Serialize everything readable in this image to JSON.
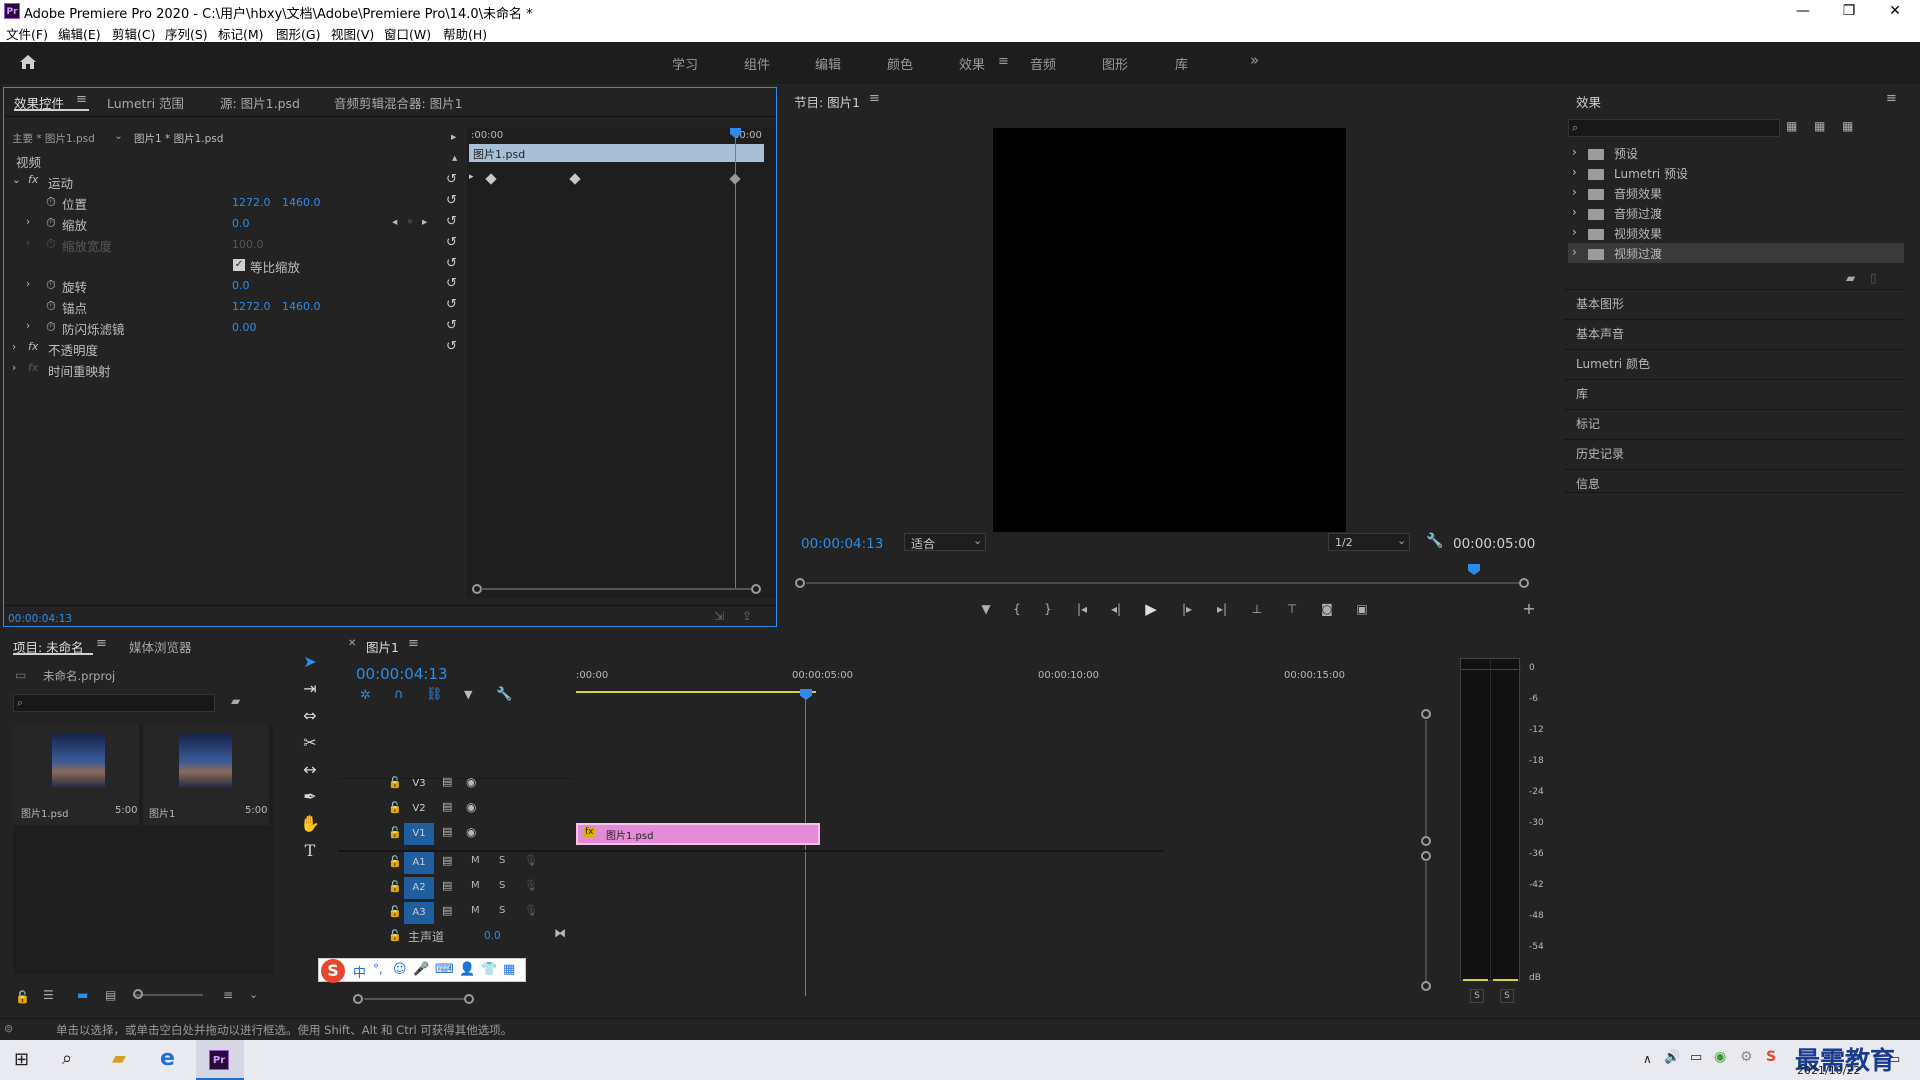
{
  "window": {
    "title": "Adobe Premiere Pro 2020 - C:\\用户\\hbxy\\文档\\Adobe\\Premiere Pro\\14.0\\未命名 *",
    "logo": "Pr",
    "minimize": "—",
    "restore": "❐",
    "close": "✕"
  },
  "menu": [
    "文件(F)",
    "编辑(E)",
    "剪辑(C)",
    "序列(S)",
    "标记(M)",
    "图形(G)",
    "视图(V)",
    "窗口(W)",
    "帮助(H)"
  ],
  "workspaces": {
    "tabs": [
      "学习",
      "组件",
      "编辑",
      "颜色",
      "效果",
      "音频",
      "图形",
      "库"
    ],
    "active": "效果",
    "more": "»"
  },
  "effect_controls": {
    "tabs": [
      "效果控件",
      "Lumetri 范围",
      "源: 图片1.psd",
      "音频剪辑混合器: 图片1"
    ],
    "master": "主要 * 图片1.psd",
    "clip": "图片1 * 图片1.psd",
    "section_video": "视频",
    "ruler_start": ":00:00",
    "ruler_end": "00:00",
    "clip_bar": "图片1.psd",
    "motion": "运动",
    "position_label": "位置",
    "position_x": "1272.0",
    "position_y": "1460.0",
    "scale_label": "缩放",
    "scale_value": "0.0",
    "scale_width_label": "缩放宽度",
    "scale_width_value": "100.0",
    "uniform_scale_label": "等比缩放",
    "uniform_scale_checked": true,
    "rotation_label": "旋转",
    "rotation_value": "0.0",
    "anchor_label": "锚点",
    "anchor_x": "1272.0",
    "anchor_y": "1460.0",
    "antiflicker_label": "防闪烁滤镜",
    "antiflicker_value": "0.00",
    "opacity": "不透明度",
    "time_remap": "时间重映射",
    "timecode": "00:00:04:13"
  },
  "program_monitor": {
    "title": "节目: 图片1",
    "timecode": "00:00:04:13",
    "fit": "适合",
    "resolution": "1/2",
    "duration": "00:00:05:00"
  },
  "effects_panel": {
    "title": "效果",
    "search_placeholder": "",
    "folders": [
      "预设",
      "Lumetri 预设",
      "音频效果",
      "音频过渡",
      "视频效果",
      "视频过渡"
    ],
    "selected_folder": "视频过渡",
    "sections": [
      "基本图形",
      "基本声音",
      "Lumetri 颜色",
      "库",
      "标记",
      "历史记录",
      "信息"
    ]
  },
  "project_panel": {
    "tabs": [
      "项目: 未命名",
      "媒体浏览器"
    ],
    "project_file": "未命名.prproj",
    "items": [
      {
        "name": "图片1.psd",
        "duration": "5:00"
      },
      {
        "name": "图片1",
        "duration": "5:00"
      }
    ]
  },
  "timeline": {
    "tab_title": "图片1",
    "timecode": "00:00:04:13",
    "ruler": [
      ":00:00",
      "00:00:05:00",
      "00:00:10:00",
      "00:00:15:00"
    ],
    "video_tracks": [
      "V3",
      "V2",
      "V1"
    ],
    "audio_tracks": [
      "A1",
      "A2",
      "A3"
    ],
    "master_label": "主声道",
    "master_value": "0.0",
    "clip_label": "图片1.psd",
    "mute": "M",
    "solo": "S"
  },
  "meters": {
    "scale": [
      "0",
      "-6",
      "-12",
      "-18",
      "-24",
      "-30",
      "-36",
      "-42",
      "-48",
      "-54",
      "dB"
    ],
    "solo_buttons": [
      "S",
      "S"
    ]
  },
  "ime_toolbar": {
    "lang": "中"
  },
  "statusbar": {
    "text": "单击以选择，或单击空白处并拖动以进行框选。使用 Shift、Alt 和 Ctrl 可获得其他选项。"
  },
  "taskbar": {
    "date": "2021/10/22",
    "watermark": "最需教育"
  },
  "colors": {
    "accent": "#2d8ceb",
    "clip_pink": "#e58ad6",
    "bg": "#232323"
  }
}
